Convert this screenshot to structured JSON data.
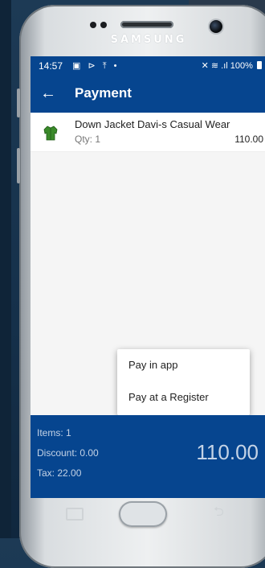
{
  "device": {
    "brand": "SAMSUNG"
  },
  "status_bar": {
    "time": "14:57",
    "battery": "100%",
    "icons": "▣ ⊳ ⤒ •",
    "signal": "✕ ≋ .ıl"
  },
  "app_bar": {
    "title": "Payment",
    "back_icon": "←"
  },
  "order": {
    "items": [
      {
        "name": "Down Jacket Davi-s Casual Wear",
        "qty": "Qty: 1",
        "price": "110.00"
      }
    ]
  },
  "popup_menu": {
    "items": [
      "Pay in app",
      "Pay at a Register"
    ]
  },
  "summary": {
    "items_count": "Items: 1",
    "discount": "Discount: 0.00",
    "tax": "Tax: 22.00",
    "total": "110.00"
  },
  "colors": {
    "primary": "#06458f",
    "surface": "#ffffff",
    "background": "#f5f5f5"
  }
}
